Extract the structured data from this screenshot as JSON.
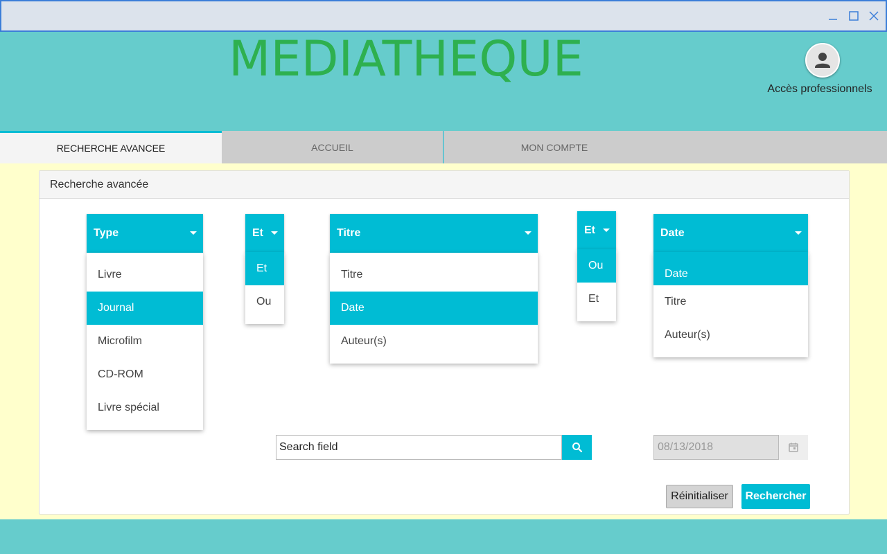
{
  "window": {
    "minimize_icon": "minimize-icon",
    "maximize_icon": "maximize-icon",
    "close_icon": "close-icon"
  },
  "header": {
    "title": "MEDIATHEQUE",
    "pro_access": "Accès professionnels",
    "avatar_icon": "person-icon"
  },
  "tabs": [
    {
      "label": "RECHERCHE AVANCEE",
      "active": true
    },
    {
      "label": "ACCUEIL",
      "active": false
    },
    {
      "label": "MON COMPTE",
      "active": false
    }
  ],
  "panel": {
    "title": "Recherche avancée"
  },
  "combos": {
    "type": {
      "label": "Type",
      "options": [
        "Livre",
        "Journal",
        "Microfilm",
        "CD-ROM",
        "Livre spécial"
      ],
      "selected": "Journal"
    },
    "op1": {
      "label": "Et",
      "options": [
        "Et",
        "Ou"
      ],
      "selected": "Et"
    },
    "field1": {
      "label": "Titre",
      "options": [
        "Titre",
        "Date",
        "Auteur(s)"
      ],
      "selected": "Date"
    },
    "op2": {
      "label": "Et",
      "options": [
        "Ou",
        "Et"
      ],
      "selected": "Ou"
    },
    "field2": {
      "label": "Date",
      "options": [
        "Date",
        "Titre",
        "Auteur(s)"
      ],
      "selected": "Date"
    }
  },
  "search": {
    "value": "Search field",
    "icon": "search-icon"
  },
  "date": {
    "value": "08/13/2018",
    "icon": "calendar-icon"
  },
  "buttons": {
    "reset": "Réinitialiser",
    "search": "Rechercher"
  },
  "colors": {
    "accent": "#00bcd4",
    "title_green": "#2eb04f",
    "header_bg": "#66cccc",
    "content_bg": "#ffffcc"
  }
}
